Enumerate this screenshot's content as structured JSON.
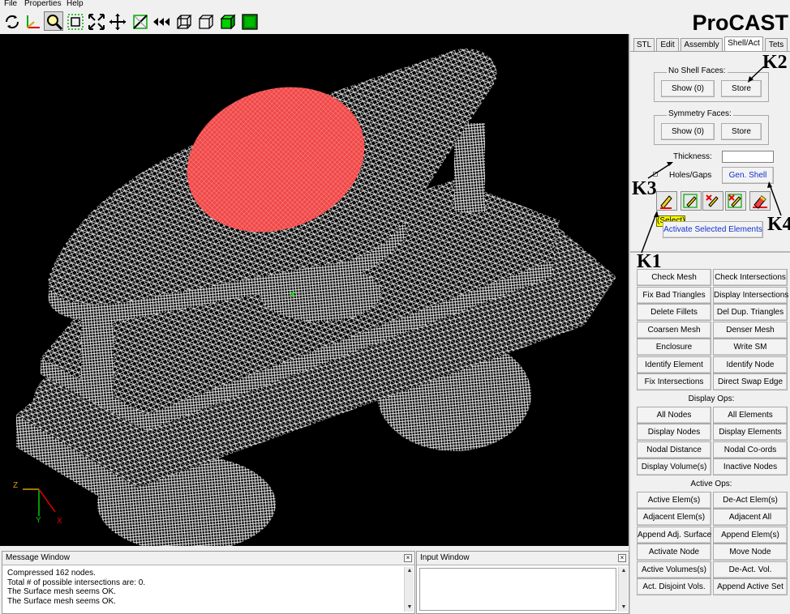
{
  "menu": [
    "File",
    "Properties",
    "Help"
  ],
  "brand": "ProCAST",
  "toolbar_icons": [
    "rotate-icon",
    "axes-icon",
    "zoom-icon",
    "zoom-box-icon",
    "fit-icon",
    "pan-icon",
    "slice-icon",
    "rewind-icon",
    "wireframe-box-icon",
    "hidden-box-icon",
    "solid-box-icon",
    "shaded-box-icon"
  ],
  "viewport": {
    "axis_labels": {
      "z": "Z",
      "y": "Y",
      "x": "X"
    },
    "colors": {
      "background": "#000000",
      "mesh": "#ffffff",
      "selected_face": "#f04848"
    }
  },
  "tabs": [
    "STL",
    "Edit",
    "Assembly",
    "Shell/Act",
    "Tets"
  ],
  "selected_tab": "Shell/Act",
  "no_shell_faces": {
    "title": "No Shell Faces:",
    "show": "Show (0)",
    "store": "Store"
  },
  "symmetry_faces": {
    "title": "Symmetry Faces:",
    "show": "Show (0)",
    "store": "Store"
  },
  "thickness_label": "Thickness:",
  "thickness_value": "",
  "holes_label": "Holes/Gaps",
  "gen_shell": "Gen. Shell",
  "select_tooltip": "(Select)",
  "activate_selected": "Activate Selected Elements",
  "annotations": {
    "k1": "K1",
    "k2": "K2",
    "k3": "K3",
    "k4": "K4"
  },
  "mesh_buttons": [
    [
      "Check Mesh",
      "Check Intersections"
    ],
    [
      "Fix Bad Triangles",
      "Display Intersections"
    ],
    [
      "Delete Fillets",
      "Del Dup. Triangles"
    ],
    [
      "Coarsen Mesh",
      "Denser Mesh"
    ],
    [
      "Enclosure",
      "Write SM"
    ],
    [
      "Identify Element",
      "Identify Node"
    ],
    [
      "Fix Intersections",
      "Direct Swap Edge"
    ]
  ],
  "display_ops": {
    "title": "Display Ops:",
    "buttons": [
      [
        "All Nodes",
        "All Elements"
      ],
      [
        "Display Nodes",
        "Display Elements"
      ],
      [
        "Nodal Distance",
        "Nodal Co-ords"
      ],
      [
        "Display Volume(s)",
        "Inactive Nodes"
      ]
    ]
  },
  "active_ops": {
    "title": "Active Ops:",
    "buttons": [
      [
        "Active Elem(s)",
        "De-Act Elem(s)"
      ],
      [
        "Adjacent Elem(s)",
        "Adjacent All"
      ],
      [
        "Append Adj. Surface",
        "Append Elem(s)"
      ],
      [
        "Activate Node",
        "Move Node"
      ],
      [
        "Active Volumes(s)",
        "De-Act. Vol."
      ],
      [
        "Act. Disjoint Vols.",
        "Append Active Set"
      ]
    ]
  },
  "message_window": {
    "title": "Message Window",
    "lines": [
      "Compressed 162 nodes.",
      "Total # of possible intersections are: 0.",
      "The Surface mesh seems OK.",
      "The Surface mesh seems OK."
    ]
  },
  "input_window": {
    "title": "Input Window",
    "value": ""
  }
}
